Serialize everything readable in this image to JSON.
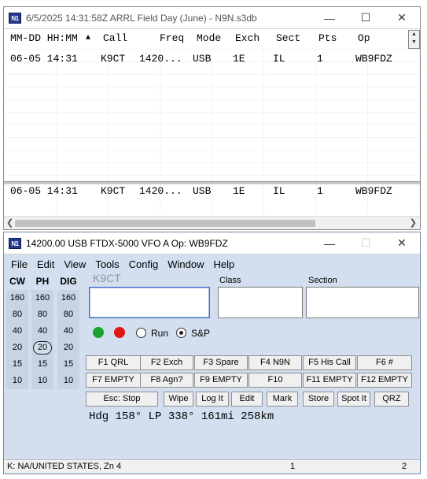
{
  "log_window": {
    "title": "6/5/2025 14:31:58Z  ARRL Field Day (June) - N9N.s3db",
    "icon_text": "N1",
    "columns": [
      "MM-DD HH:MM",
      "▲",
      "Call",
      "Freq",
      "Mode",
      "Exch",
      "Sect",
      "Pts",
      "Op"
    ],
    "rows": [
      {
        "date": "06-05 14:31",
        "call": "K9CT",
        "freq": "1420...",
        "mode": "USB",
        "exch": "1E",
        "sect": "IL",
        "pts": "1",
        "op": "WB9FDZ"
      }
    ],
    "lower_rows": [
      {
        "date": "06-05 14:31",
        "call": "K9CT",
        "freq": "1420...",
        "mode": "USB",
        "exch": "1E",
        "sect": "IL",
        "pts": "1",
        "op": "WB9FDZ"
      }
    ]
  },
  "entry_window": {
    "title": "14200.00 USB FTDX-5000 VFO A    Op: WB9FDZ",
    "icon_text": "N1",
    "menu": [
      "File",
      "Edit",
      "View",
      "Tools",
      "Config",
      "Window",
      "Help"
    ],
    "band_headers": [
      "CW",
      "PH",
      "DIG"
    ],
    "bands": [
      "160",
      "80",
      "40",
      "20",
      "15",
      "10"
    ],
    "selected_band": "20",
    "ghost_call": "K9CT",
    "fields": {
      "class_label": "Class",
      "section_label": "Section"
    },
    "radio": {
      "run": "Run",
      "sp": "S&P",
      "selected": "S&P"
    },
    "led_colors": {
      "green": "#1aa32a",
      "red": "#e01515"
    },
    "fkeys_row1": [
      "F1 QRL",
      "F2 Exch",
      "F3 Spare",
      "F4 N9N",
      "F5 His Call",
      "F6 #"
    ],
    "fkeys_row2": [
      "F7 EMPTY",
      "F8 Agn?",
      "F9 EMPTY",
      "F10",
      "F11 EMPTY",
      "F12 EMPTY"
    ],
    "bottom_buttons": [
      "Esc: Stop",
      "Wipe",
      "Log It",
      "Edit",
      "Mark",
      "Store",
      "Spot It",
      "QRZ"
    ],
    "info_line": "Hdg 158° LP 338° 161mi 258km",
    "status": {
      "left": "K: NA/UNITED STATES, Zn 4",
      "middle": "1",
      "right": "2"
    }
  }
}
